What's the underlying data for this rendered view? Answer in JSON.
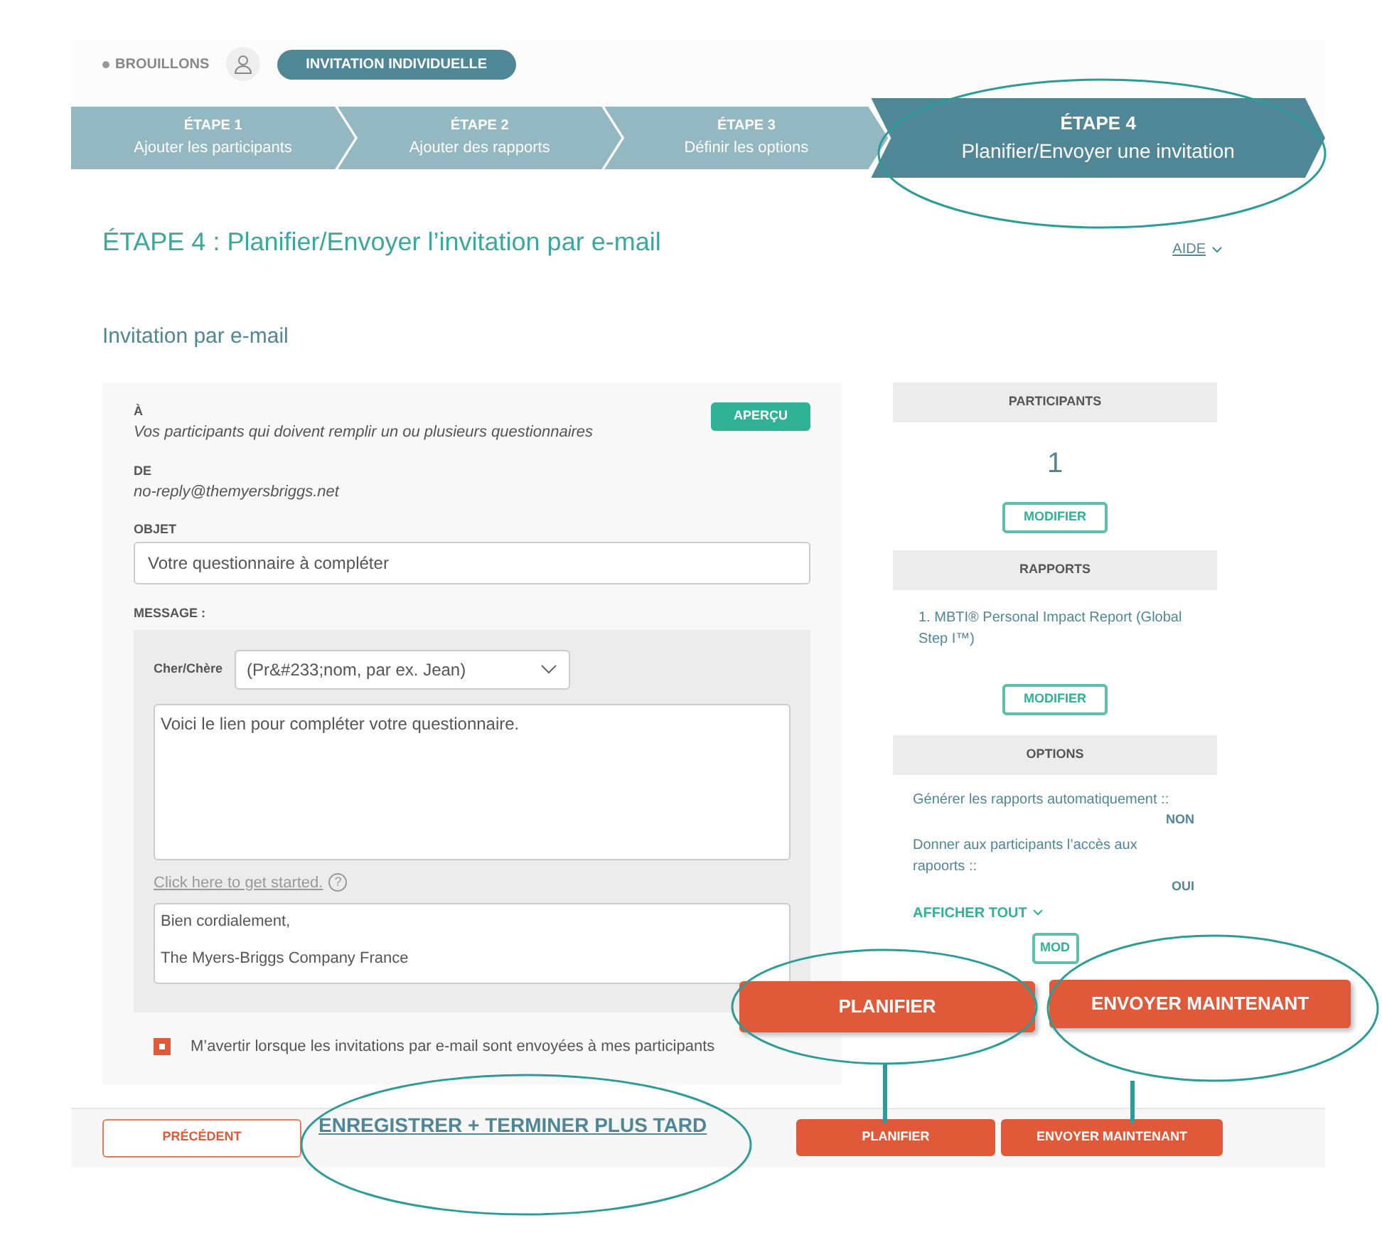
{
  "header": {
    "status": "BROUILLONS",
    "badge": "INVITATION INDIVIDUELLE"
  },
  "steps": [
    {
      "title": "ÉTAPE 1",
      "label": "Ajouter les participants",
      "selected": false
    },
    {
      "title": "ÉTAPE 2",
      "label": "Ajouter des rapports",
      "selected": false
    },
    {
      "title": "ÉTAPE 3",
      "label": "Définir les options",
      "selected": false
    },
    {
      "title": "ÉTAPE 4",
      "label": "Planifier/Envoyer une invitation",
      "selected": true
    }
  ],
  "page_title": "ÉTAPE 4 : Planifier/Envoyer l’invitation par e-mail",
  "help_link": "AIDE",
  "section_title": "Invitation par e-mail",
  "form": {
    "to_label": "À",
    "to_value": "Vos participants qui doivent remplir un ou plusieurs questionnaires",
    "preview_button": "APERÇU",
    "from_label": "DE",
    "from_value": "no-reply@themyersbriggs.net",
    "subject_label": "OBJET",
    "subject_value": "Votre questionnaire à compléter",
    "message_label": "MESSAGE :",
    "salutation_label": "Cher/Chère",
    "salutation_value": "(Pr&#233;nom, par ex. Jean)",
    "body": "Voici le lien pour compléter votre questionnaire.",
    "help_link": "Click here to get started.",
    "help_icon": "?",
    "signature": [
      "Bien cordialement,",
      "The Myers-Briggs Company France"
    ],
    "notify": {
      "label": "M’avertir lorsque les invitations par e-mail sont envoyées à mes participants",
      "checked": true
    }
  },
  "summary": {
    "participants": {
      "heading": "PARTICIPANTS",
      "count": "1",
      "button": "MODIFIER"
    },
    "reports": {
      "heading": "RAPPORTS",
      "items": [
        "1. MBTI® Personal Impact Report (Global Step I™)"
      ],
      "button": "MODIFIER"
    },
    "options": {
      "heading": "OPTIONS",
      "items": [
        {
          "label": "Générer les rapports automatiquement ::",
          "value": "NON"
        },
        {
          "label": "Donner aux participants l’accès aux rapoorts ::",
          "value": "OUI"
        }
      ],
      "show_all": "AFFICHER TOUT",
      "button": "MOD"
    }
  },
  "footer": {
    "back": "PRÉCÉDENT",
    "save": "ENREGISTRER + TERMINER PLUS TARD",
    "schedule": "PLANIFIER",
    "send": "ENVOYER MAINTENANT"
  },
  "callouts": [
    {
      "label": "PLANIFIER"
    },
    {
      "label": "ENVOYER MAINTENANT"
    }
  ]
}
